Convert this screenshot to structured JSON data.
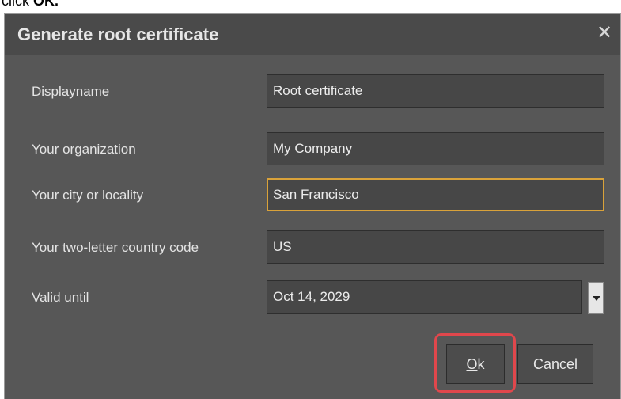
{
  "instruction": {
    "prefix": "click ",
    "strong": "OK."
  },
  "dialog": {
    "title": "Generate root certificate",
    "close_symbol": "✕",
    "fields": [
      {
        "label": "Displayname",
        "value": "Root certificate"
      },
      {
        "label": "Your organization",
        "value": "My Company"
      },
      {
        "label": "Your city or locality",
        "value": "San Francisco",
        "focused": true
      },
      {
        "label": "Your two-letter country code",
        "value": "US"
      },
      {
        "label": "Valid until",
        "value": "Oct 14, 2029"
      }
    ],
    "buttons": {
      "ok": "Ok",
      "cancel": "Cancel"
    },
    "highlight_color": "#e0474c",
    "focus_color": "#d9a23a"
  }
}
